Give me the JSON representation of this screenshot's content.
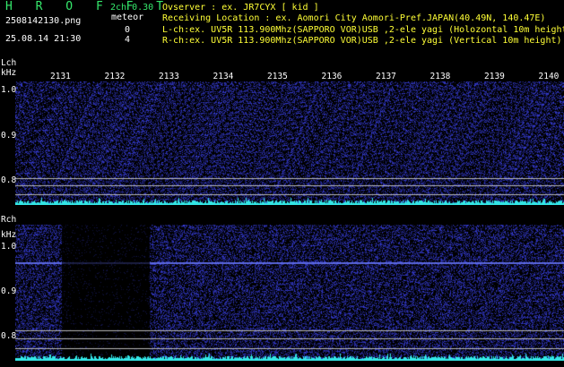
{
  "header": {
    "title": "H R O F F T",
    "filename": "2508142130.png",
    "timestamp": "25.08.14 21:30",
    "channel_mode": "2ch 0.30",
    "meteor_label": "meteor",
    "lch_count": "0",
    "rch_count": "4",
    "observer": "Ovserver          : ex. JR7CYX [ kid ]",
    "location": "Receiving Location : ex. Aomori City Aomori-Pref.JAPAN(40.49N, 140.47E)",
    "lch_info": "L-ch:ex. UV5R 113.900Mhz(SAPPORO VOR)USB ,2-ele yagi (Holozontal 10m height)",
    "rch_info": "R-ch:ex. UV5R 113.900Mhz(SAPPORO VOR)USB ,2-ele yagi (Vertical 10m height)"
  },
  "time_ticks": [
    "2131",
    "2132",
    "2133",
    "2134",
    "2135",
    "2136",
    "2137",
    "2138",
    "2139",
    "2140"
  ],
  "lch_panel": {
    "label": "Lch",
    "unit": "kHz",
    "y_labels": [
      "1.0",
      "0.9",
      "0.8"
    ]
  },
  "rch_panel": {
    "label": "Rch",
    "unit": "kHz",
    "y_labels": [
      "1.0",
      "0.9",
      "0.8"
    ]
  },
  "colors": {
    "background": "#000000",
    "noise": "#2a3aa8",
    "signal_line": "#6a78ff",
    "ref_line": "#c0c0c0",
    "level_bar": "#33e6e6",
    "label_white": "#ffffff",
    "label_green": "#35e86c",
    "label_yellow": "#ffff36"
  }
}
